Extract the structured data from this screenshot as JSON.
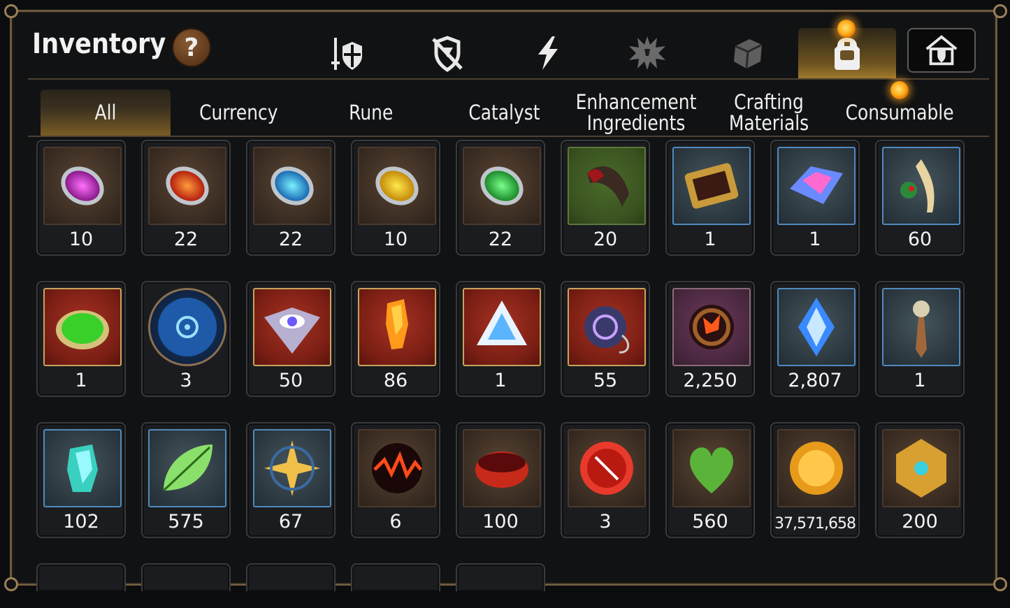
{
  "header": {
    "title": "Inventory",
    "help_label": "?"
  },
  "top_nav": [
    {
      "name": "champion-gear-icon",
      "active": false
    },
    {
      "name": "no-shield-icon",
      "active": false
    },
    {
      "name": "lightning-icon",
      "active": false
    },
    {
      "name": "splat-icon",
      "active": false
    },
    {
      "name": "cube-icon",
      "active": false
    },
    {
      "name": "backpack-icon",
      "active": true
    }
  ],
  "tabs": [
    {
      "label": "All",
      "active": true
    },
    {
      "label": "Currency",
      "active": false
    },
    {
      "label": "Rune",
      "active": false
    },
    {
      "label": "Catalyst",
      "active": false
    },
    {
      "label": "Enhancement Ingredients",
      "active": false
    },
    {
      "label": "Crafting Materials",
      "active": false
    },
    {
      "label": "Consumable",
      "active": false
    }
  ],
  "items": [
    {
      "name": "pink-rune-icon",
      "count": "10"
    },
    {
      "name": "red-rune-icon",
      "count": "22"
    },
    {
      "name": "blue-rune-icon",
      "count": "22"
    },
    {
      "name": "yellow-rune-icon",
      "count": "10"
    },
    {
      "name": "green-rune-icon",
      "count": "22"
    },
    {
      "name": "claw-icon",
      "count": "20"
    },
    {
      "name": "circuit-device-icon",
      "count": "1"
    },
    {
      "name": "crystal-shard-icon",
      "count": "1"
    },
    {
      "name": "herb-root-icon",
      "count": "60"
    },
    {
      "name": "green-gem-icon",
      "count": "1"
    },
    {
      "name": "blue-sigil-icon",
      "count": "3"
    },
    {
      "name": "eye-emblem-icon",
      "count": "50"
    },
    {
      "name": "orange-crystal-icon",
      "count": "86"
    },
    {
      "name": "triangle-knot-icon",
      "count": "1"
    },
    {
      "name": "pendant-icon",
      "count": "55"
    },
    {
      "name": "red-flower-ring-icon",
      "count": "2,250"
    },
    {
      "name": "blue-crystal-icon",
      "count": "2,807"
    },
    {
      "name": "compass-dagger-icon",
      "count": "1"
    },
    {
      "name": "teal-crystal-icon",
      "count": "102"
    },
    {
      "name": "green-leaf-icon",
      "count": "575"
    },
    {
      "name": "star-amulet-icon",
      "count": "67"
    },
    {
      "name": "lava-orb-icon",
      "count": "6"
    },
    {
      "name": "red-band-icon",
      "count": "100"
    },
    {
      "name": "red-seal-icon",
      "count": "3"
    },
    {
      "name": "green-heart-icon",
      "count": "560"
    },
    {
      "name": "gold-coin-icon",
      "count": "37,571,658"
    },
    {
      "name": "gold-emblem-icon",
      "count": "200"
    }
  ],
  "colors": {
    "accent_gold": "#b48a34",
    "notification": "#ffae1a",
    "frame": "#6e5a3e"
  }
}
